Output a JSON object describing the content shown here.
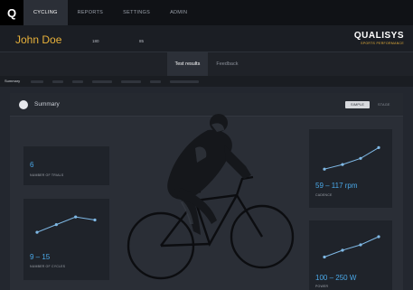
{
  "nav": {
    "logo": "Q",
    "items": [
      {
        "label": "CYCLING",
        "active": true
      },
      {
        "label": "Reports",
        "active": false
      },
      {
        "label": "Settings",
        "active": false
      },
      {
        "label": "Admin",
        "active": false
      }
    ]
  },
  "profile": {
    "name": "John Doe",
    "fields": [
      {
        "label": "",
        "value": ""
      },
      {
        "label": "",
        "value": "180"
      },
      {
        "label": "",
        "value": ""
      },
      {
        "label": "",
        "value": "85"
      },
      {
        "label": "",
        "value": ""
      }
    ]
  },
  "brand": {
    "name": "QUALISYS",
    "tagline": "SPORTS PERFORMANCE"
  },
  "tabs": [
    {
      "label": "Test results",
      "active": true
    },
    {
      "label": "Feedback",
      "active": false
    }
  ],
  "subnav": {
    "active": "Summary"
  },
  "panel": {
    "title": "Summary",
    "views": [
      {
        "label": "SIMPLE",
        "active": true
      },
      {
        "label": "STAGE",
        "active": false
      }
    ]
  },
  "stats": {
    "trials": {
      "value": "6",
      "label": "NUMBER OF TRIALS"
    },
    "cycles": {
      "value": "9 – 15",
      "label": "NUMBER OF CYCLES",
      "trend": [
        0.35,
        0.6,
        0.85,
        0.75
      ]
    },
    "cadence": {
      "value": "59 – 117 rpm",
      "label": "CADENCE",
      "trend": [
        0.2,
        0.35,
        0.55,
        0.9
      ]
    },
    "power": {
      "value": "100 – 250 W",
      "label": "POWER",
      "trend": [
        0.15,
        0.4,
        0.6,
        0.9
      ]
    }
  },
  "colors": {
    "accent": "#e8b13a",
    "value": "#4aa8e8",
    "spark": "#7fb9e6"
  },
  "icons": {
    "panel": "summary-icon",
    "rider": "cyclist-3d-model"
  }
}
